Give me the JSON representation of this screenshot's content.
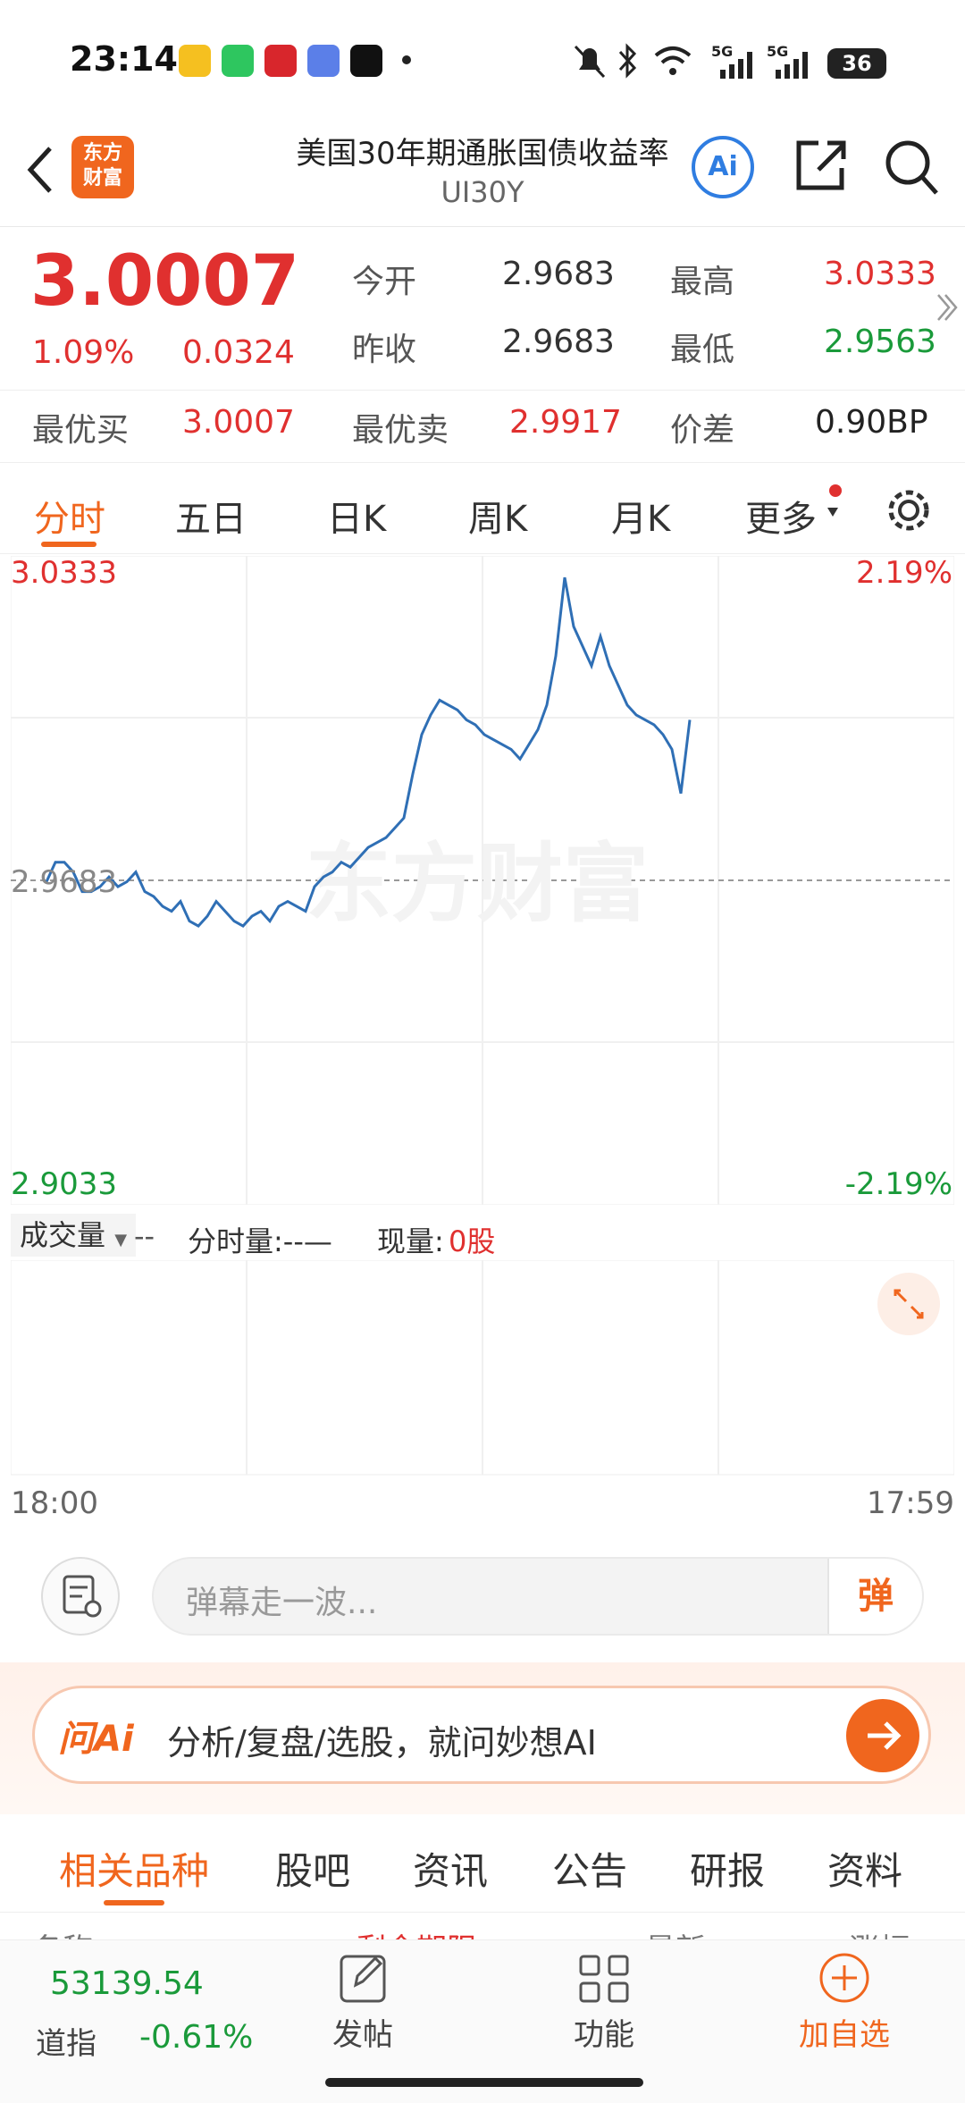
{
  "status": {
    "time": "23:14",
    "battery": "36",
    "signal1": "5G",
    "signal2": "5G"
  },
  "header": {
    "title": "美国30年期通胀国债收益率",
    "code": "UI30Y",
    "logo_top": "东方",
    "logo_bottom": "财富",
    "ai_label": "Ai"
  },
  "quote": {
    "price": "3.0007",
    "change_pct": "1.09%",
    "change": "0.0324",
    "open_label": "今开",
    "open": "2.9683",
    "high_label": "最高",
    "high": "3.0333",
    "prev_label": "昨收",
    "prev": "2.9683",
    "low_label": "最低",
    "low": "2.9563",
    "bid_label": "最优买",
    "bid": "3.0007",
    "ask_label": "最优卖",
    "ask": "2.9917",
    "spread_label": "价差",
    "spread": "0.90BP"
  },
  "tabs": [
    "分时",
    "五日",
    "日K",
    "周K",
    "月K",
    "更多"
  ],
  "chart_labels": {
    "top_left": "3.0333",
    "top_right": "2.19%",
    "mid_left": "2.9683",
    "bottom_left": "2.9033",
    "bottom_right": "-2.19%",
    "watermark": "东方财富"
  },
  "volume": {
    "label": "成交量",
    "dash": "--",
    "minute_label": "分时量:--—",
    "current_label": "现量:",
    "current_value": "0股",
    "start_time": "18:00",
    "end_time": "17:59"
  },
  "danmu": {
    "placeholder": "弹幕走一波...",
    "button": "弹"
  },
  "ai_bar": {
    "logo": "问Ai",
    "text": "分析/复盘/选股，就问妙想AI"
  },
  "related_tabs": [
    "相关品种",
    "股吧",
    "资讯",
    "公告",
    "研报",
    "资料"
  ],
  "partial_header": {
    "c1": "名称",
    "c2": "剩余期限",
    "c3": "最新",
    "c4": "涨幅"
  },
  "bottom": {
    "index_value": "53139.54",
    "index_name": "道指",
    "index_change": "-0.61%",
    "post": "发帖",
    "func": "功能",
    "add": "加自选"
  },
  "colors": {
    "up": "#e0302f",
    "down": "#1a9a3a",
    "accent": "#f0661e",
    "line": "#2f6fb5"
  },
  "chart_data": {
    "type": "line",
    "ylim": [
      2.9033,
      3.0333
    ],
    "baseline": 2.9683,
    "x": [
      "18:00",
      "17:59"
    ],
    "values": [
      2.968,
      2.972,
      2.972,
      2.97,
      2.966,
      2.966,
      2.967,
      2.969,
      2.967,
      2.968,
      2.97,
      2.966,
      2.965,
      2.963,
      2.962,
      2.964,
      2.96,
      2.959,
      2.961,
      2.964,
      2.962,
      2.96,
      2.959,
      2.961,
      2.962,
      2.96,
      2.963,
      2.964,
      2.963,
      2.962,
      2.967,
      2.969,
      2.97,
      2.972,
      2.971,
      2.973,
      2.975,
      2.976,
      2.977,
      2.979,
      2.981,
      2.99,
      2.998,
      3.002,
      3.005,
      3.004,
      3.003,
      3.001,
      3.0,
      2.998,
      2.997,
      2.996,
      2.995,
      2.993,
      2.996,
      2.999,
      3.004,
      3.014,
      3.03,
      3.02,
      3.016,
      3.012,
      3.018,
      3.012,
      3.008,
      3.004,
      3.002,
      3.001,
      3.0,
      2.998,
      2.995,
      2.986,
      3.001
    ]
  }
}
